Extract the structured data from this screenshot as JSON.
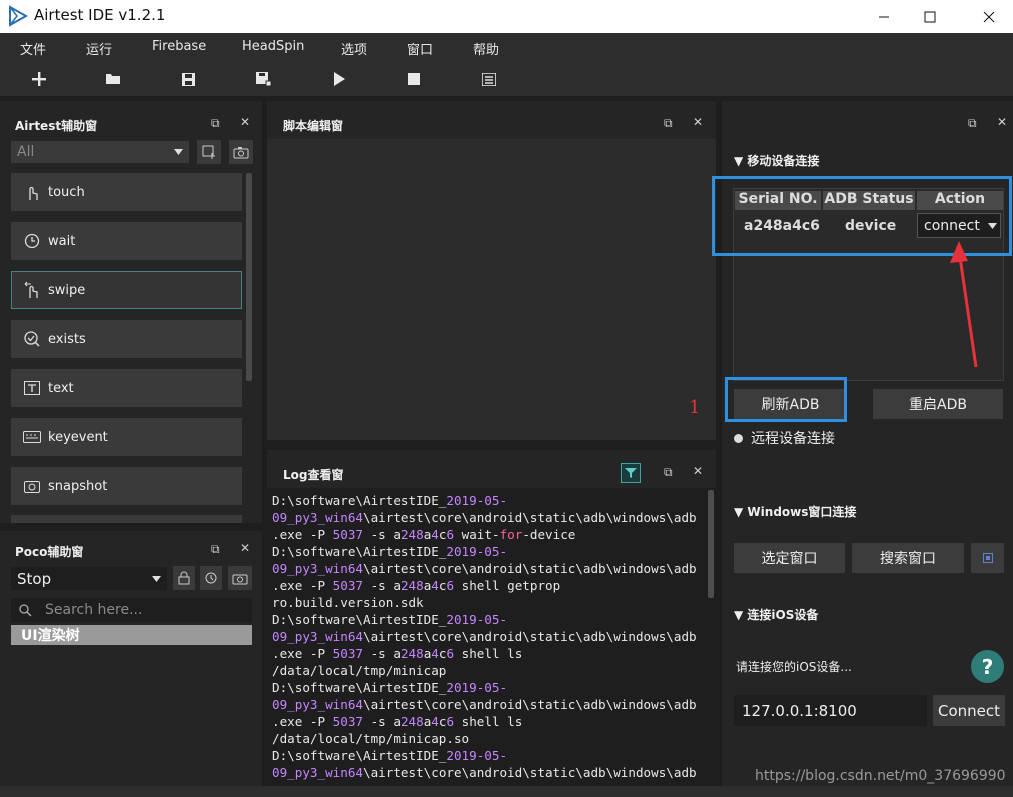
{
  "window": {
    "title": "Airtest IDE v1.2.1"
  },
  "menu": [
    "文件",
    "运行",
    "Firebase",
    "HeadSpin",
    "选项",
    "窗口",
    "帮助"
  ],
  "toolbar": {
    "icons": [
      "plus-icon",
      "open-folder-icon",
      "save-icon",
      "save-as-icon",
      "play-icon",
      "stop-icon",
      "log-icon"
    ]
  },
  "airtest_panel": {
    "title": "Airtest辅助窗",
    "filter": "All",
    "items": [
      {
        "label": "touch",
        "icon": "touch-icon"
      },
      {
        "label": "wait",
        "icon": "clock-icon"
      },
      {
        "label": "swipe",
        "icon": "swipe-icon"
      },
      {
        "label": "exists",
        "icon": "exists-icon"
      },
      {
        "label": "text",
        "icon": "text-icon"
      },
      {
        "label": "keyevent",
        "icon": "keyboard-icon"
      },
      {
        "label": "snapshot",
        "icon": "camera-icon"
      }
    ]
  },
  "poco_panel": {
    "title": "Poco辅助窗",
    "mode": "Stop",
    "search_placeholder": "Search here...",
    "tree_root": "UI渲染树"
  },
  "editor_panel": {
    "title": "脚本编辑窗",
    "annotation": "1"
  },
  "log_panel": {
    "title": "Log查看窗",
    "lines": [
      [
        {
          "t": "D:\\software\\AirtestIDE_"
        },
        {
          "t": "2019-05-",
          "h": 1
        }
      ],
      [
        {
          "t": "09_py3_win64",
          "h": 1
        },
        {
          "t": "\\airtest\\core\\android\\static\\adb\\windows\\adb"
        }
      ],
      [
        {
          "t": ".exe -P "
        },
        {
          "t": "5037",
          "h": 1
        },
        {
          "t": " -s a"
        },
        {
          "t": "248",
          "h": 1
        },
        {
          "t": "a"
        },
        {
          "t": "4",
          "h": 1
        },
        {
          "t": "c"
        },
        {
          "t": "6",
          "h": 1
        },
        {
          "t": " wait-"
        },
        {
          "t": "for",
          "h": 2
        },
        {
          "t": "-device"
        }
      ],
      [
        {
          "t": "D:\\software\\AirtestIDE_"
        },
        {
          "t": "2019-05-",
          "h": 1
        }
      ],
      [
        {
          "t": "09_py3_win64",
          "h": 1
        },
        {
          "t": "\\airtest\\core\\android\\static\\adb\\windows\\adb"
        }
      ],
      [
        {
          "t": ".exe -P "
        },
        {
          "t": "5037",
          "h": 1
        },
        {
          "t": " -s a"
        },
        {
          "t": "248",
          "h": 1
        },
        {
          "t": "a"
        },
        {
          "t": "4",
          "h": 1
        },
        {
          "t": "c"
        },
        {
          "t": "6",
          "h": 1
        },
        {
          "t": " shell getprop"
        }
      ],
      [
        {
          "t": "ro.build.version.sdk"
        }
      ],
      [
        {
          "t": "D:\\software\\AirtestIDE_"
        },
        {
          "t": "2019-05-",
          "h": 1
        }
      ],
      [
        {
          "t": "09_py3_win64",
          "h": 1
        },
        {
          "t": "\\airtest\\core\\android\\static\\adb\\windows\\adb"
        }
      ],
      [
        {
          "t": ".exe -P "
        },
        {
          "t": "5037",
          "h": 1
        },
        {
          "t": " -s a"
        },
        {
          "t": "248",
          "h": 1
        },
        {
          "t": "a"
        },
        {
          "t": "4",
          "h": 1
        },
        {
          "t": "c"
        },
        {
          "t": "6",
          "h": 1
        },
        {
          "t": " shell ls"
        }
      ],
      [
        {
          "t": "/data/local/tmp/minicap"
        }
      ],
      [
        {
          "t": "D:\\software\\AirtestIDE_"
        },
        {
          "t": "2019-05-",
          "h": 1
        }
      ],
      [
        {
          "t": "09_py3_win64",
          "h": 1
        },
        {
          "t": "\\airtest\\core\\android\\static\\adb\\windows\\adb"
        }
      ],
      [
        {
          "t": ".exe -P "
        },
        {
          "t": "5037",
          "h": 1
        },
        {
          "t": " -s a"
        },
        {
          "t": "248",
          "h": 1
        },
        {
          "t": "a"
        },
        {
          "t": "4",
          "h": 1
        },
        {
          "t": "c"
        },
        {
          "t": "6",
          "h": 1
        },
        {
          "t": " shell ls"
        }
      ],
      [
        {
          "t": "/data/local/tmp/minicap.so"
        }
      ],
      [
        {
          "t": "D:\\software\\AirtestIDE_"
        },
        {
          "t": "2019-05-",
          "h": 1
        }
      ],
      [
        {
          "t": "09_py3_win64",
          "h": 1
        },
        {
          "t": "\\airtest\\core\\android\\static\\adb\\windows\\adb"
        }
      ]
    ]
  },
  "device_panel": {
    "mobile_section": "移动设备连接",
    "table": {
      "headers": [
        "Serial NO.",
        "ADB Status",
        "Action"
      ],
      "row": {
        "serial": "a248a4c6",
        "status": "device",
        "action": "connect"
      }
    },
    "refresh_adb": "刷新ADB",
    "restart_adb": "重启ADB",
    "remote_label": "远程设备连接",
    "windows_section": "Windows窗口连接",
    "select_window": "选定窗口",
    "search_window": "搜索窗口",
    "ios_section": "连接iOS设备",
    "ios_hint": "请连接您的iOS设备...",
    "ios_address": "127.0.0.1:8100",
    "connect_button": "Connect"
  },
  "watermark": "https://blog.csdn.net/m0_37696990",
  "colors": {
    "highlight_box": "#2f8fe0",
    "arrow": "#e8323b",
    "annotation": "#e8323b",
    "log_keyword": "#c586ff"
  }
}
